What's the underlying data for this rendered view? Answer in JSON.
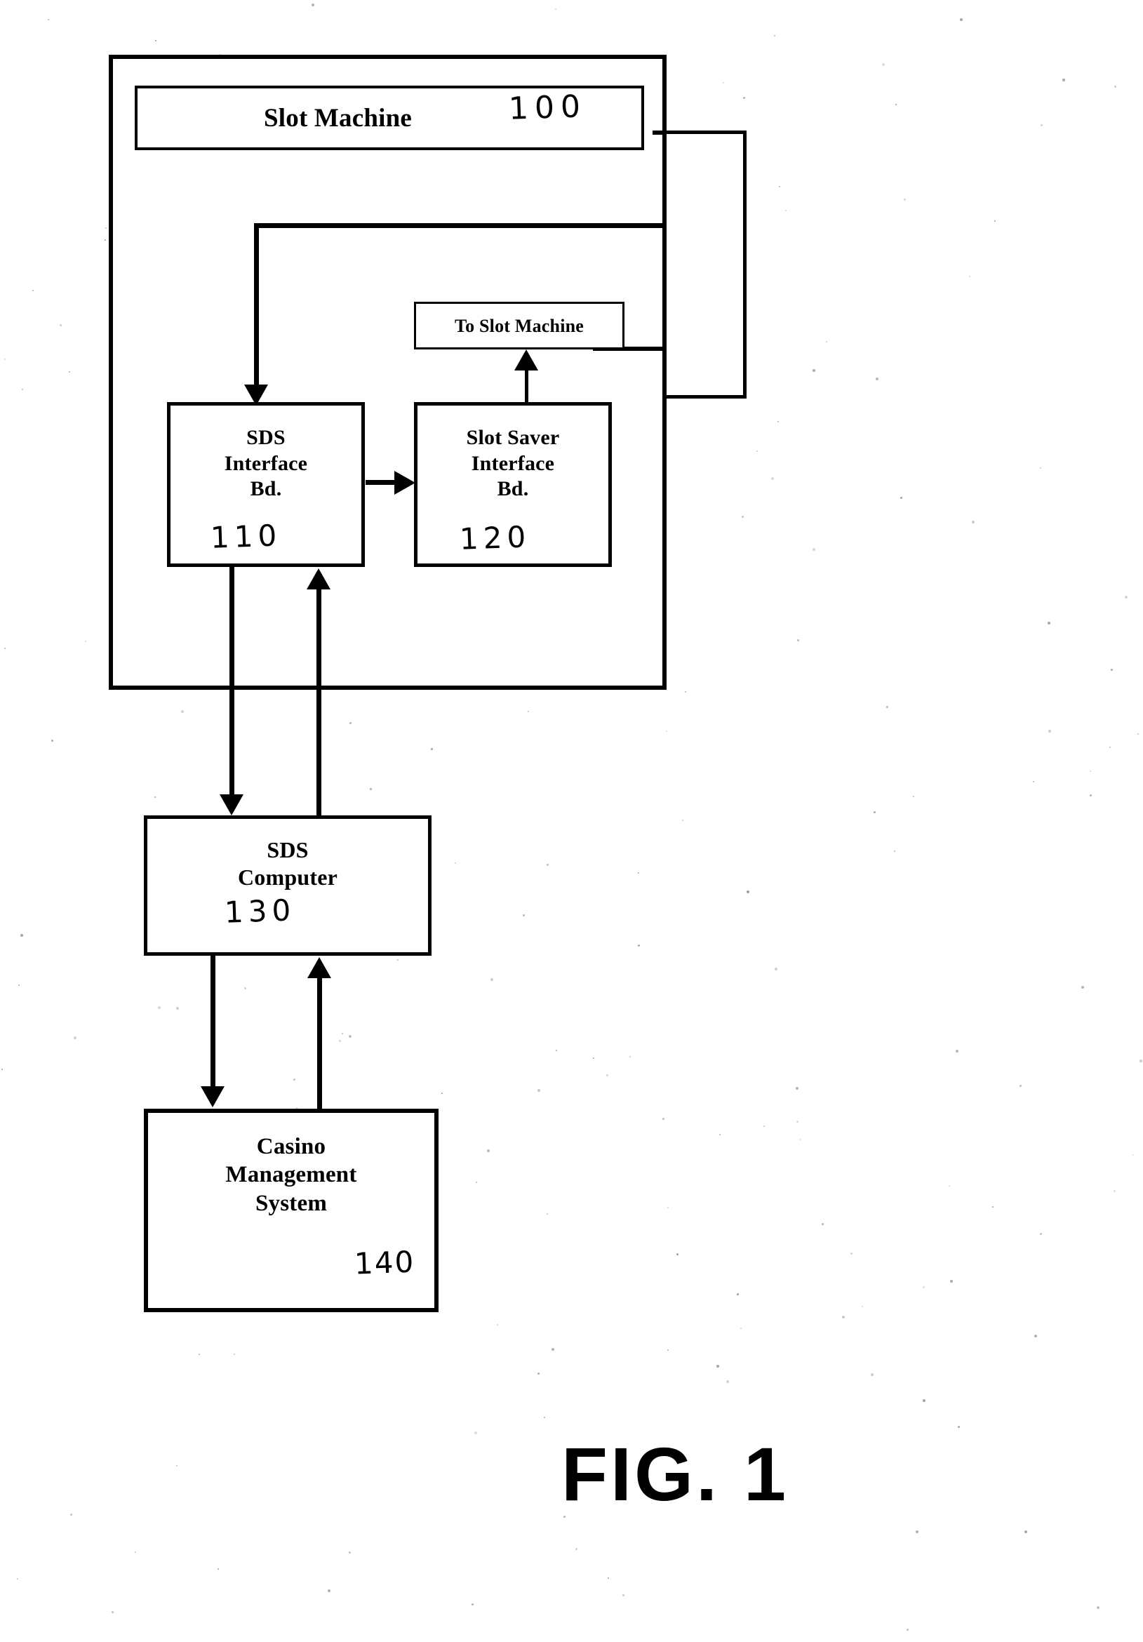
{
  "figure": {
    "caption": "FIG. 1",
    "type": "block-diagram",
    "title_note": "Slot machine data system block diagram"
  },
  "boxes": {
    "slot_machine_container": {
      "name": "Slot Machine outer enclosure",
      "label": "",
      "ref": ""
    },
    "slot_machine_title": {
      "label": "Slot Machine",
      "ref": "100"
    },
    "to_slot_machine": {
      "label": "To Slot Machine",
      "ref": ""
    },
    "sds_interface": {
      "label": "SDS\nInterface\nBd.",
      "line1": "SDS",
      "line2": "Interface",
      "line3": "Bd.",
      "ref": "110"
    },
    "slot_saver_interface": {
      "label": "Slot Saver\nInterface\nBd.",
      "line1": "Slot Saver",
      "line2": "Interface",
      "line3": "Bd.",
      "ref": "120"
    },
    "sds_computer": {
      "line1": "SDS",
      "line2": "Computer",
      "ref": "130"
    },
    "casino_management": {
      "line1": "Casino",
      "line2": "Management",
      "line3": "System",
      "ref": "140"
    }
  },
  "connections": [
    {
      "from": "slot-machine-container",
      "to": "sds-interface",
      "style": "arrow-down",
      "description": "Return loop from right side down and left into SDS Interface Bd."
    },
    {
      "from": "sds-interface",
      "to": "slot-saver-interface",
      "style": "arrow-right",
      "description": "SDS Interface Bd. to Slot Saver Interface Bd."
    },
    {
      "from": "slot-saver-interface",
      "to": "to-slot-machine",
      "style": "arrow-up",
      "description": "Slot Saver Interface Bd. up to To Slot Machine"
    },
    {
      "from": "sds-interface",
      "to": "sds-computer",
      "style": "arrow-down",
      "description": "SDS Interface Bd. down to SDS Computer"
    },
    {
      "from": "sds-computer",
      "to": "sds-interface",
      "style": "arrow-up",
      "description": "SDS Computer up to SDS Interface Bd."
    },
    {
      "from": "sds-computer",
      "to": "casino-management",
      "style": "arrow-down",
      "description": "SDS Computer down to Casino Management System"
    },
    {
      "from": "casino-management",
      "to": "sds-computer",
      "style": "arrow-up",
      "description": "Casino Management System up to SDS Computer"
    }
  ],
  "colors": {
    "ink": "#000000",
    "paper": "#ffffff"
  }
}
